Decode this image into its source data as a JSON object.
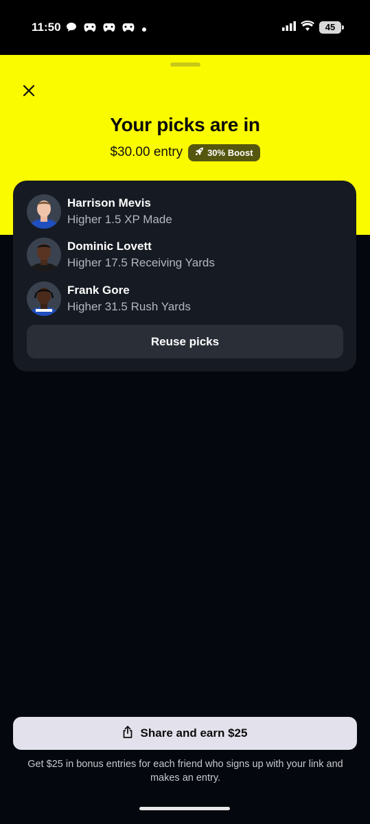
{
  "status_bar": {
    "time": "11:50",
    "battery": "45",
    "notification_icons": [
      "chat-bubble-icon",
      "game-controller-icon",
      "game-controller-icon",
      "game-controller-icon",
      "dot-icon"
    ]
  },
  "header": {
    "title": "Your picks are in",
    "entry_amount": "$30.00 entry",
    "boost_label": "30% Boost"
  },
  "picks": [
    {
      "name": "Harrison Mevis",
      "detail": "Higher 1.5 XP Made"
    },
    {
      "name": "Dominic Lovett",
      "detail": "Higher 17.5 Receiving Yards"
    },
    {
      "name": "Frank Gore",
      "detail": "Higher 31.5 Rush Yards"
    }
  ],
  "actions": {
    "reuse_label": "Reuse picks",
    "share_label": "Share and earn $25",
    "share_note": "Get $25 in bonus entries for each friend who signs up with your link and makes an entry."
  },
  "colors": {
    "accent": "#fbfb00",
    "background": "#04070d",
    "card": "#161a22",
    "boost_badge": "#56570f"
  }
}
